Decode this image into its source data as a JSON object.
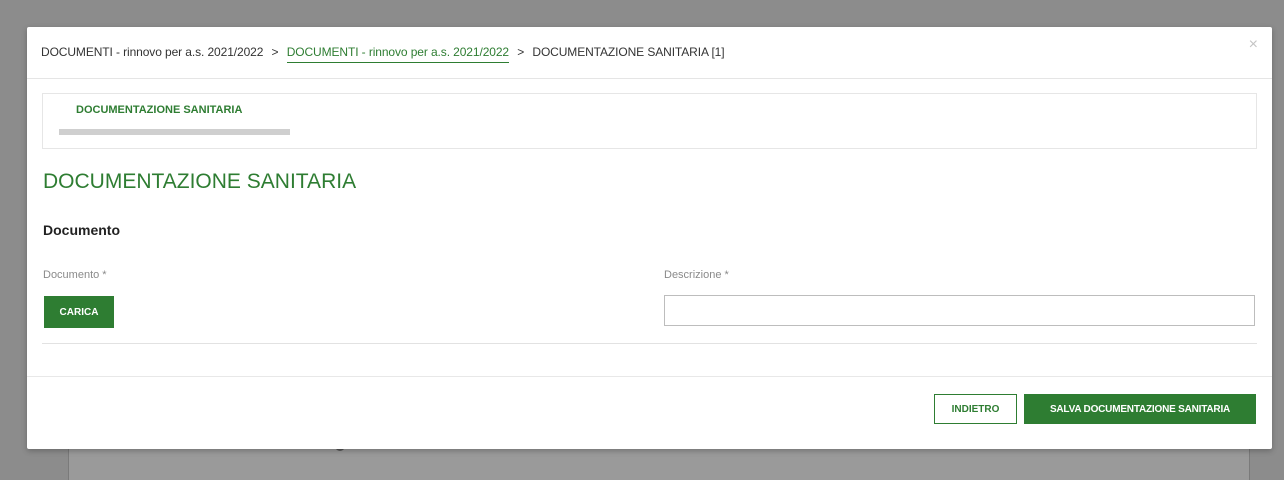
{
  "breadcrumb": {
    "item1": "DOCUMENTI - rinnovo per a.s. 2021/2022",
    "item2": "DOCUMENTI - rinnovo per a.s. 2021/2022",
    "item3": "DOCUMENTAZIONE SANITARIA [1]",
    "separator": ">"
  },
  "close_symbol": "×",
  "tabs": [
    {
      "label": "DOCUMENTAZIONE SANITARIA",
      "active": true
    }
  ],
  "page_title": "DOCUMENTAZIONE SANITARIA",
  "section_title": "Documento",
  "form": {
    "documento_label": "Documento *",
    "carica_label": "CARICA",
    "descrizione_label": "Descrizione *",
    "descrizione_value": ""
  },
  "footer": {
    "back_label": "INDIETRO",
    "save_label": "SALVA DOCUMENTAZIONE SANITARIA"
  },
  "colors": {
    "accent": "#2e7d32",
    "overlay": "#8c8c8c",
    "tab_underline": "#cfcfcf"
  },
  "icons": {
    "close": "close-icon"
  }
}
